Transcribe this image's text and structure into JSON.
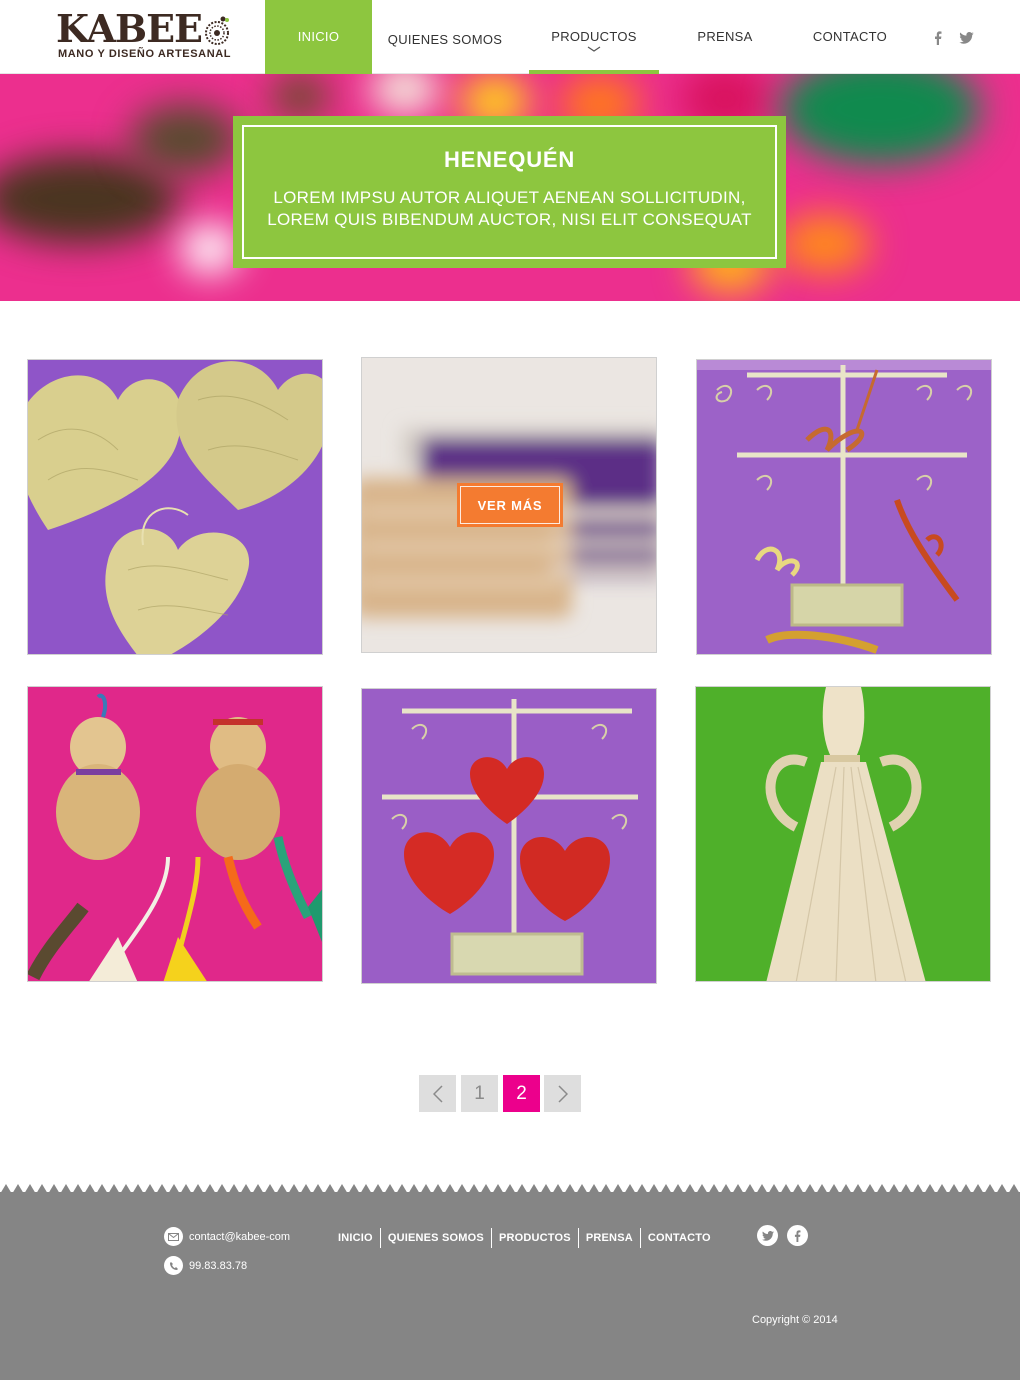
{
  "brand": {
    "name": "KABEE",
    "tagline": "MANO Y DISEÑO ARTESANAL",
    "color_green": "#8dc63f",
    "color_pink": "#ec008c",
    "color_orange": "#f47b30",
    "color_brown": "#3d2a22"
  },
  "nav": {
    "items": [
      {
        "label": "INICIO",
        "active": true
      },
      {
        "label": "QUIENES SOMOS",
        "active": false
      },
      {
        "label": "PRODUCTOS",
        "active": false,
        "has_dropdown": true
      },
      {
        "label": "PRENSA",
        "active": false
      },
      {
        "label": "CONTACTO",
        "active": false
      }
    ],
    "social": [
      "facebook-icon",
      "twitter-icon"
    ]
  },
  "hero": {
    "title": "HENEQUÉN",
    "text": "LOREM IMPSU AUTOR ALIQUET AENEAN SOLLICITUDIN, LOREM QUIS BIBENDUM AUCTOR, NISI ELIT CONSEQUAT"
  },
  "products": {
    "tiles": [
      {
        "subject": "woven heart coasters on purple"
      },
      {
        "subject": "woven basket (blurred, hover)",
        "button": "VER MÁS"
      },
      {
        "subject": "jewelry stand with ribbons on purple"
      },
      {
        "subject": "gourds with tassels on pink"
      },
      {
        "subject": "stand with red woven hearts on purple"
      },
      {
        "subject": "henequen fiber angel on green"
      }
    ]
  },
  "pagination": {
    "prev": "‹",
    "pages": [
      "1",
      "2"
    ],
    "current": "2",
    "next": "›"
  },
  "footer": {
    "email": "contact@kabee-com",
    "phone": "99.83.83.78",
    "nav": [
      "INICIO",
      "QUIENES SOMOS",
      "PRODUCTOS",
      "PRENSA",
      "CONTACTO"
    ],
    "social": [
      "twitter-icon",
      "facebook-icon"
    ],
    "copyright": "Copyright © 2014"
  }
}
